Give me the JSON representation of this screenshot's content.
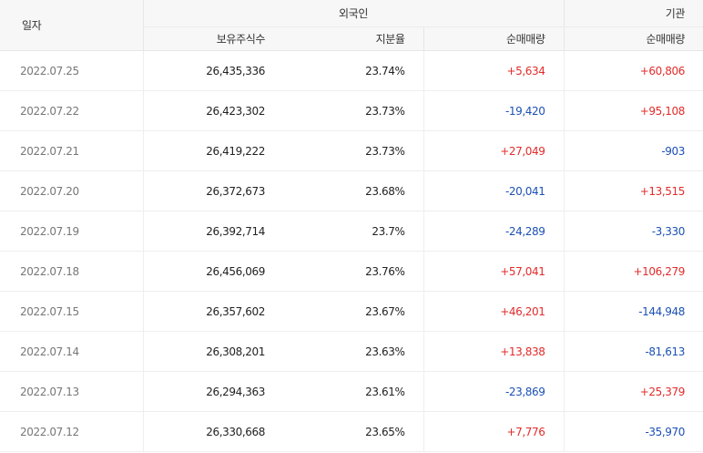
{
  "header": {
    "date": "일자",
    "foreign": "외국인",
    "institution": "기관",
    "holdings": "보유주식수",
    "share_ratio": "지분율",
    "foreign_net": "순매매량",
    "inst_net": "순매매량"
  },
  "rows": [
    {
      "date": "2022.07.25",
      "holdings": "26,435,336",
      "ratio": "23.74%",
      "foreign_net": "+5,634",
      "inst_net": "+60,806"
    },
    {
      "date": "2022.07.22",
      "holdings": "26,423,302",
      "ratio": "23.73%",
      "foreign_net": "-19,420",
      "inst_net": "+95,108"
    },
    {
      "date": "2022.07.21",
      "holdings": "26,419,222",
      "ratio": "23.73%",
      "foreign_net": "+27,049",
      "inst_net": "-903"
    },
    {
      "date": "2022.07.20",
      "holdings": "26,372,673",
      "ratio": "23.68%",
      "foreign_net": "-20,041",
      "inst_net": "+13,515"
    },
    {
      "date": "2022.07.19",
      "holdings": "26,392,714",
      "ratio": "23.7%",
      "foreign_net": "-24,289",
      "inst_net": "-3,330"
    },
    {
      "date": "2022.07.18",
      "holdings": "26,456,069",
      "ratio": "23.76%",
      "foreign_net": "+57,041",
      "inst_net": "+106,279"
    },
    {
      "date": "2022.07.15",
      "holdings": "26,357,602",
      "ratio": "23.67%",
      "foreign_net": "+46,201",
      "inst_net": "-144,948"
    },
    {
      "date": "2022.07.14",
      "holdings": "26,308,201",
      "ratio": "23.63%",
      "foreign_net": "+13,838",
      "inst_net": "-81,613"
    },
    {
      "date": "2022.07.13",
      "holdings": "26,294,363",
      "ratio": "23.61%",
      "foreign_net": "-23,869",
      "inst_net": "+25,379"
    },
    {
      "date": "2022.07.12",
      "holdings": "26,330,668",
      "ratio": "23.65%",
      "foreign_net": "+7,776",
      "inst_net": "-35,970"
    }
  ],
  "colors": {
    "up": "#e32b2b",
    "down": "#1c50b4"
  }
}
